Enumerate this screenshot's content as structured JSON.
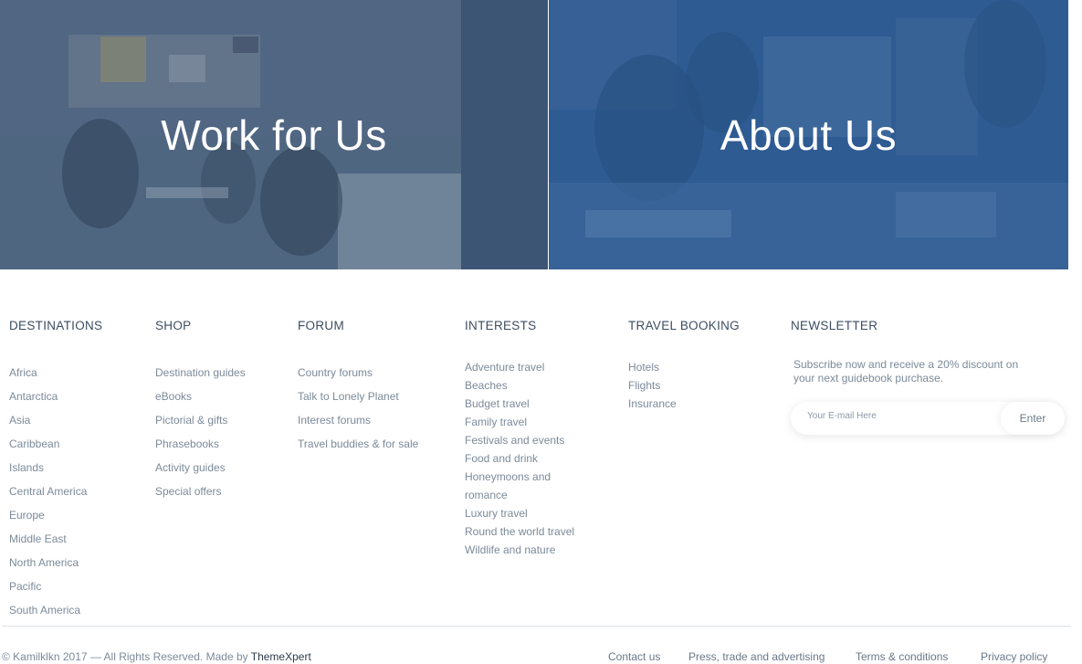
{
  "hero": {
    "left_title": "Work for Us",
    "right_title": "About Us"
  },
  "colors": {
    "left_panel_tint": "#3f5877",
    "right_panel_tint": "#2f5b93",
    "text_muted": "#7c8a99",
    "heading": "#3d4d60"
  },
  "columns": {
    "destinations": {
      "heading": "DESTINATIONS",
      "items": [
        "Africa",
        "Antarctica",
        "Asia",
        "Caribbean",
        "Islands",
        "Central America",
        "Europe",
        "Middle East",
        "North America",
        "Pacific",
        "South America"
      ]
    },
    "shop": {
      "heading": "SHOP",
      "items": [
        "Destination guides",
        "eBooks",
        "Pictorial & gifts",
        "Phrasebooks",
        "Activity guides",
        "Special offers"
      ]
    },
    "forum": {
      "heading": "FORUM",
      "items": [
        "Country forums",
        "Talk to Lonely Planet",
        "Interest forums",
        "Travel buddies & for sale"
      ]
    },
    "interests": {
      "heading": "INTERESTS",
      "items": [
        "Adventure travel",
        "Beaches",
        "Budget travel",
        "Family travel",
        "Festivals and events",
        "Food and drink",
        "Honeymoons and romance",
        "Luxury travel",
        "Round the world travel",
        "Wildlife and nature"
      ]
    },
    "travel_booking": {
      "heading": "TRAVEL BOOKING",
      "items": [
        "Hotels",
        "Flights",
        "Insurance"
      ]
    },
    "newsletter": {
      "heading": "NEWSLETTER",
      "text": "Subscribe now and receive a 20% discount on your next guidebook purchase.",
      "placeholder": "Your E-mail Here",
      "button": "Enter"
    }
  },
  "footer": {
    "copyright": "© Kamilklkn 2017 — All Rights Reserved. Made by",
    "credit_link": "ThemeXpert",
    "links": [
      "Contact us",
      "Press, trade and advertising",
      "Terms & conditions",
      "Privacy policy"
    ]
  }
}
